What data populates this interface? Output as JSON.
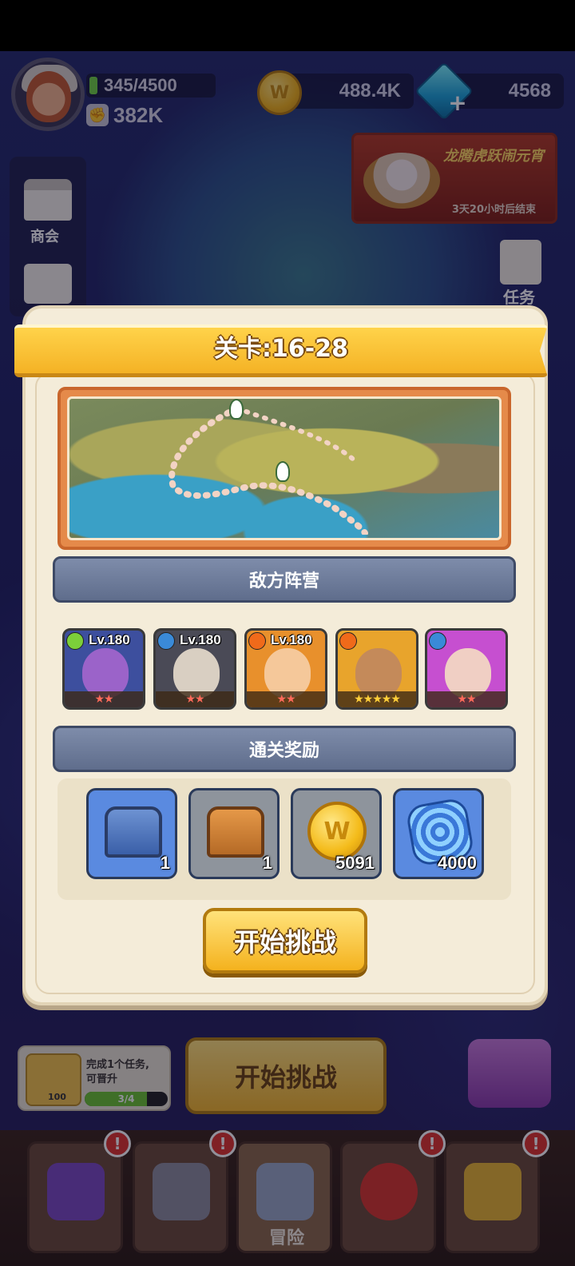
{
  "hud": {
    "energy": "345/4500",
    "power": "382K",
    "gold": "488.4K",
    "gems": "4568",
    "event_title": "龙腾虎跃闹元宵",
    "event_time": "3天20小时后结束",
    "shop_label": "商会",
    "task_label": "任务"
  },
  "dialog": {
    "title": "关卡:16-28",
    "enemy_header": "敌方阵营",
    "reward_header": "通关奖励",
    "start_button": "开始挑战",
    "enemies": [
      {
        "level": "Lv.180",
        "element": "leaf",
        "element_color": "#7ccf3a",
        "stars": 2,
        "bg": "#3d4f9e",
        "skin": "#9b63c9"
      },
      {
        "level": "Lv.180",
        "element": "water",
        "element_color": "#3a8ad8",
        "stars": 2,
        "bg": "#4a4a56",
        "skin": "#d9cfc2"
      },
      {
        "level": "Lv.180",
        "element": "fire",
        "element_color": "#f06a1a",
        "stars": 2,
        "bg": "#e8902c",
        "skin": "#f5c89a"
      },
      {
        "level": "",
        "element": "fire",
        "element_color": "#f06a1a",
        "stars": 5,
        "bg": "#e8a42c",
        "skin": "#c48a5a"
      },
      {
        "level": "",
        "element": "water",
        "element_color": "#3a8ad8",
        "stars": 2,
        "bg": "#c64fd0",
        "skin": "#f0cfc4"
      }
    ],
    "rewards": [
      {
        "name": "blue-chest",
        "count": "1",
        "bg": "#5a8ae0"
      },
      {
        "name": "wooden-chest",
        "count": "1",
        "bg": "#8e949c"
      },
      {
        "name": "gold-coin",
        "count": "5091",
        "bg": "#8e949c"
      },
      {
        "name": "blue-swirl-stone",
        "count": "4000",
        "bg": "#5a8ae0"
      }
    ]
  },
  "background": {
    "quest_text_line1": "完成1个任务,",
    "quest_text_line2": "可晋升",
    "quest_level": "100",
    "quest_progress": "3/4",
    "quest_progress_fraction": 0.75,
    "start_button": "开始挑战",
    "nav_active_label": "冒险",
    "nav_badge": "!"
  }
}
